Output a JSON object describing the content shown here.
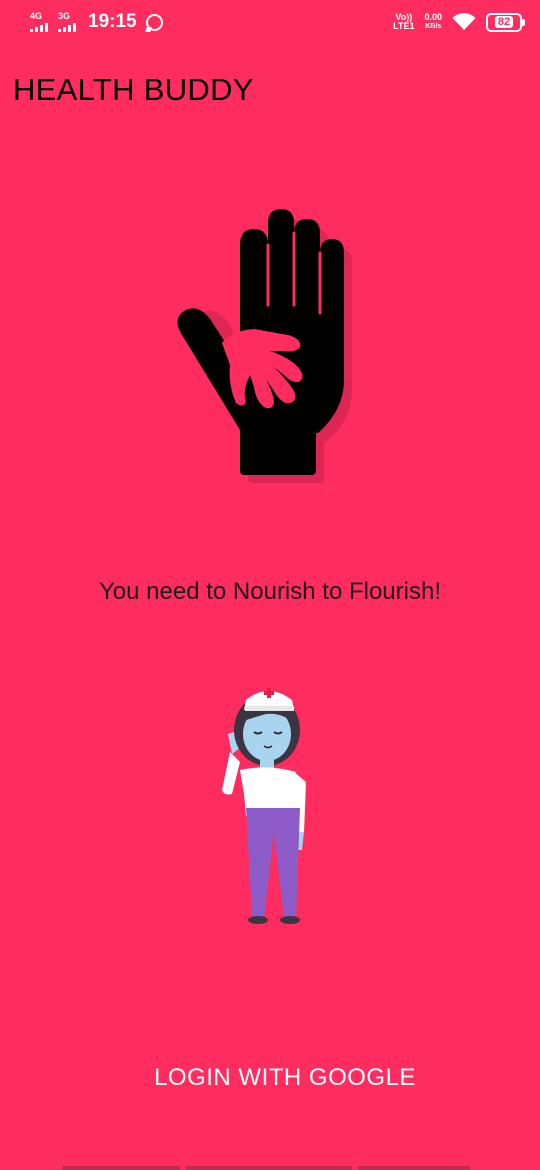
{
  "status_bar": {
    "sim1_network": "4G",
    "sim2_network": "3G",
    "time": "19:15",
    "volte_line1": "Vo))",
    "volte_line2": "LTE1",
    "speed_value": "0.00",
    "speed_unit": "KB/s",
    "battery": "82",
    "icons": [
      "signal-icon",
      "whatsapp-icon",
      "wifi-icon",
      "battery-icon"
    ]
  },
  "app": {
    "title": "HEALTH BUDDY"
  },
  "main": {
    "logo_icon": "hand-helping-hand-icon",
    "tagline": "You need to Nourish to Flourish!",
    "illustration": "nurse-saluting-illustration"
  },
  "actions": {
    "login_label": "LOGIN WITH GOOGLE"
  },
  "colors": {
    "background": "#ff2d5f",
    "title_text": "#000000",
    "button_text": "#ffffff"
  }
}
